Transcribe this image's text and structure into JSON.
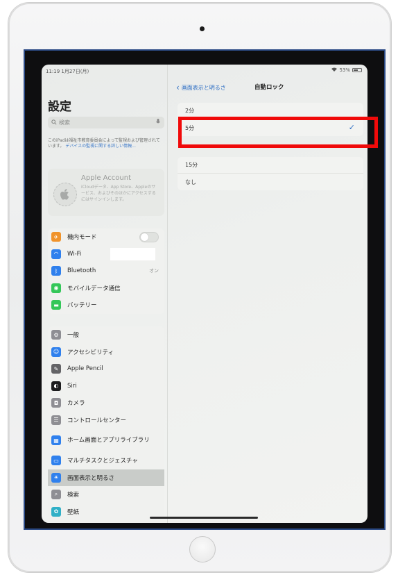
{
  "status_bar": {
    "time": "11:19  1月27日(月)",
    "battery_text": "53%"
  },
  "sidebar": {
    "title": "設定",
    "search_placeholder": "検索",
    "managed_note_text": "このiPadは福祉市教育委員会によって監視および管理されています。",
    "managed_note_link": "デバイスの監視に関する詳しい情報...",
    "account": {
      "title": "Apple Account",
      "description": "iCloudデータ、App Store、Appleのサービス、およびそのほかにアクセスするにはサインインします。"
    },
    "group_connectivity": [
      {
        "label": "機内モード",
        "icon": "airplane-icon",
        "color": "#f0932b",
        "value": ""
      },
      {
        "label": "Wi-Fi",
        "icon": "wifi-icon",
        "color": "#2f80ed",
        "value": ""
      },
      {
        "label": "Bluetooth",
        "icon": "bluetooth-icon",
        "color": "#2f80ed",
        "value": "オン"
      },
      {
        "label": "モバイルデータ通信",
        "icon": "antenna-icon",
        "color": "#34c759",
        "value": ""
      },
      {
        "label": "バッテリー",
        "icon": "battery-icon",
        "color": "#34c759",
        "value": ""
      }
    ],
    "group_general": [
      {
        "label": "一般",
        "icon": "gear-icon",
        "color": "#8e8e93"
      },
      {
        "label": "アクセシビリティ",
        "icon": "accessibility-icon",
        "color": "#2f80ed"
      },
      {
        "label": "Apple Pencil",
        "icon": "pencil-icon",
        "color": "#636366"
      },
      {
        "label": "Siri",
        "icon": "siri-icon",
        "color": "#1c1c1e"
      },
      {
        "label": "カメラ",
        "icon": "camera-icon",
        "color": "#8e8e93"
      },
      {
        "label": "コントロールセンター",
        "icon": "control-center-icon",
        "color": "#8e8e93"
      },
      {
        "label": "ホーム画面とアプリライブラリ",
        "icon": "home-screen-icon",
        "color": "#2f80ed"
      },
      {
        "label": "マルチタスクとジェスチャ",
        "icon": "multitask-icon",
        "color": "#2f80ed"
      },
      {
        "label": "画面表示と明るさ",
        "icon": "brightness-icon",
        "color": "#2f80ed"
      },
      {
        "label": "検索",
        "icon": "search-icon",
        "color": "#8e8e93"
      },
      {
        "label": "壁紙",
        "icon": "wallpaper-icon",
        "color": "#30b0c7"
      }
    ],
    "selected_item": "画面表示と明るさ"
  },
  "detail": {
    "back_label": "画面表示と明るさ",
    "title": "自動ロック",
    "options_top": [
      "2分",
      "5分"
    ],
    "options_bottom": [
      "15分",
      "なし"
    ],
    "selected_option": "5分",
    "check_glyph": "✓"
  },
  "annotation": {
    "highlight_color": "#f00a0a"
  }
}
